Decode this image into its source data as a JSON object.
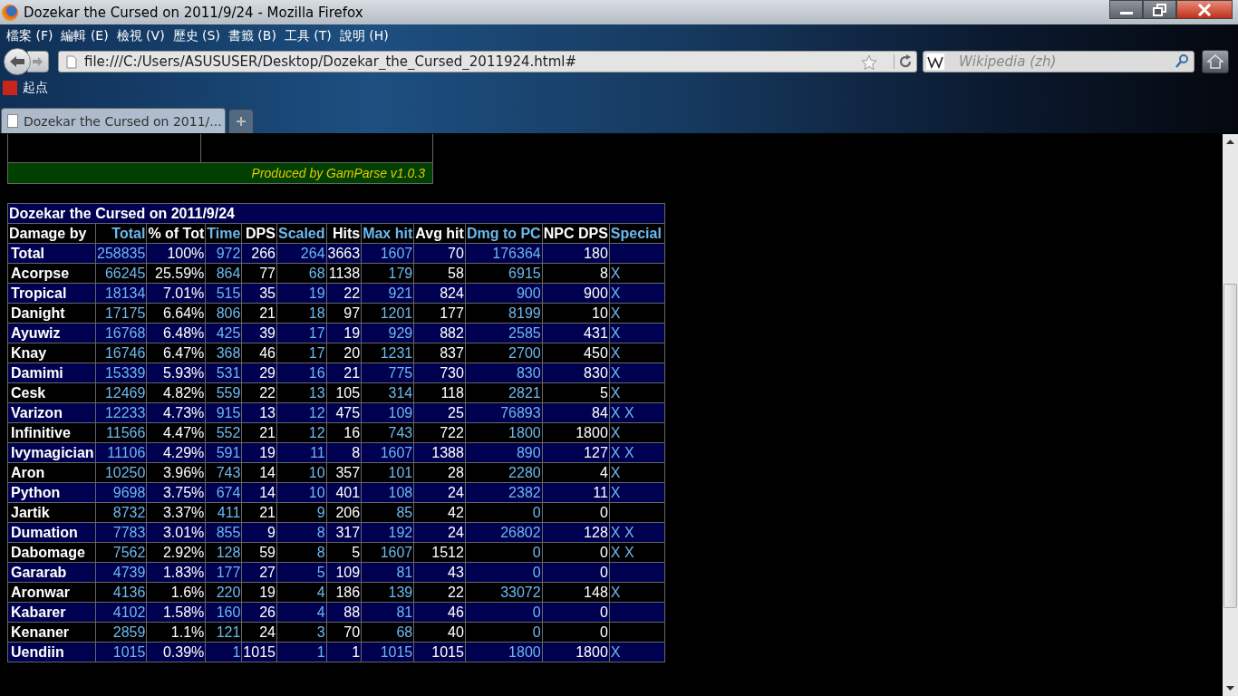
{
  "window": {
    "title": "Dozekar the Cursed on 2011/9/24 - Mozilla Firefox"
  },
  "menu": [
    "檔案 (F)",
    "編輯 (E)",
    "檢視 (V)",
    "歷史 (S)",
    "書籤 (B)",
    "工具 (T)",
    "說明 (H)"
  ],
  "address": {
    "value": "file:///C:/Users/ASUSUSER/Desktop/Dozekar_the_Cursed_2011924.html#"
  },
  "search": {
    "placeholder": "Wikipedia (zh)"
  },
  "bookmarks": [
    "起点"
  ],
  "tabs": [
    {
      "label": "Dozekar the Cursed on 2011/...",
      "selected": true
    }
  ],
  "report_footer": "Produced by GamParse v1.0.3",
  "table": {
    "title": "Dozekar the Cursed on 2011/9/24",
    "columns": [
      {
        "label": "Damage by",
        "sortable": false
      },
      {
        "label": "Total",
        "sortable": true
      },
      {
        "label": "% of Tot",
        "sortable": false
      },
      {
        "label": "Time",
        "sortable": true
      },
      {
        "label": "DPS",
        "sortable": false
      },
      {
        "label": "Scaled",
        "sortable": true
      },
      {
        "label": "Hits",
        "sortable": false
      },
      {
        "label": "Max hit",
        "sortable": true
      },
      {
        "label": "Avg hit",
        "sortable": false
      },
      {
        "label": "Dmg to PC",
        "sortable": true
      },
      {
        "label": "NPC DPS",
        "sortable": false
      },
      {
        "label": "Special",
        "sortable": true
      }
    ],
    "rows": [
      {
        "cells": [
          "Total",
          "258835",
          "100%",
          "972",
          "266",
          "264",
          "3663",
          "1607",
          "70",
          "176364",
          "180"
        ],
        "special": []
      },
      {
        "cells": [
          "Acorpse",
          "66245",
          "25.59%",
          "864",
          "77",
          "68",
          "1138",
          "179",
          "58",
          "6915",
          "8"
        ],
        "special": [
          "X"
        ]
      },
      {
        "cells": [
          "Tropical",
          "18134",
          "7.01%",
          "515",
          "35",
          "19",
          "22",
          "921",
          "824",
          "900",
          "900"
        ],
        "special": [
          "X"
        ]
      },
      {
        "cells": [
          "Danight",
          "17175",
          "6.64%",
          "806",
          "21",
          "18",
          "97",
          "1201",
          "177",
          "8199",
          "10"
        ],
        "special": [
          "X"
        ]
      },
      {
        "cells": [
          "Ayuwiz",
          "16768",
          "6.48%",
          "425",
          "39",
          "17",
          "19",
          "929",
          "882",
          "2585",
          "431"
        ],
        "special": [
          "X"
        ]
      },
      {
        "cells": [
          "Knay",
          "16746",
          "6.47%",
          "368",
          "46",
          "17",
          "20",
          "1231",
          "837",
          "2700",
          "450"
        ],
        "special": [
          "X"
        ]
      },
      {
        "cells": [
          "Damimi",
          "15339",
          "5.93%",
          "531",
          "29",
          "16",
          "21",
          "775",
          "730",
          "830",
          "830"
        ],
        "special": [
          "X"
        ]
      },
      {
        "cells": [
          "Cesk",
          "12469",
          "4.82%",
          "559",
          "22",
          "13",
          "105",
          "314",
          "118",
          "2821",
          "5"
        ],
        "special": [
          "X"
        ]
      },
      {
        "cells": [
          "Varizon",
          "12233",
          "4.73%",
          "915",
          "13",
          "12",
          "475",
          "109",
          "25",
          "76893",
          "84"
        ],
        "special": [
          "X",
          "X"
        ]
      },
      {
        "cells": [
          "Infinitive",
          "11566",
          "4.47%",
          "552",
          "21",
          "12",
          "16",
          "743",
          "722",
          "1800",
          "1800"
        ],
        "special": [
          "X"
        ]
      },
      {
        "cells": [
          "Ivymagician",
          "11106",
          "4.29%",
          "591",
          "19",
          "11",
          "8",
          "1607",
          "1388",
          "890",
          "127"
        ],
        "special": [
          "X",
          "X"
        ]
      },
      {
        "cells": [
          "Aron",
          "10250",
          "3.96%",
          "743",
          "14",
          "10",
          "357",
          "101",
          "28",
          "2280",
          "4"
        ],
        "special": [
          "X"
        ]
      },
      {
        "cells": [
          "Python",
          "9698",
          "3.75%",
          "674",
          "14",
          "10",
          "401",
          "108",
          "24",
          "2382",
          "11"
        ],
        "special": [
          "X"
        ]
      },
      {
        "cells": [
          "Jartik",
          "8732",
          "3.37%",
          "411",
          "21",
          "9",
          "206",
          "85",
          "42",
          "0",
          "0"
        ],
        "special": []
      },
      {
        "cells": [
          "Dumation",
          "7783",
          "3.01%",
          "855",
          "9",
          "8",
          "317",
          "192",
          "24",
          "26802",
          "128"
        ],
        "special": [
          "X",
          "X"
        ]
      },
      {
        "cells": [
          "Dabomage",
          "7562",
          "2.92%",
          "128",
          "59",
          "8",
          "5",
          "1607",
          "1512",
          "0",
          "0"
        ],
        "special": [
          "X",
          "X"
        ]
      },
      {
        "cells": [
          "Gararab",
          "4739",
          "1.83%",
          "177",
          "27",
          "5",
          "109",
          "81",
          "43",
          "0",
          "0"
        ],
        "special": []
      },
      {
        "cells": [
          "Aronwar",
          "4136",
          "1.6%",
          "220",
          "19",
          "4",
          "186",
          "139",
          "22",
          "33072",
          "148"
        ],
        "special": [
          "X"
        ]
      },
      {
        "cells": [
          "Kabarer",
          "4102",
          "1.58%",
          "160",
          "26",
          "4",
          "88",
          "81",
          "46",
          "0",
          "0"
        ],
        "special": []
      },
      {
        "cells": [
          "Kenaner",
          "2859",
          "1.1%",
          "121",
          "24",
          "3",
          "70",
          "68",
          "40",
          "0",
          "0"
        ],
        "special": []
      },
      {
        "cells": [
          "Uendiin",
          "1015",
          "0.39%",
          "1",
          "1015",
          "1",
          "1",
          "1015",
          "1015",
          "1800",
          "1800"
        ],
        "special": [
          "X"
        ]
      }
    ]
  }
}
